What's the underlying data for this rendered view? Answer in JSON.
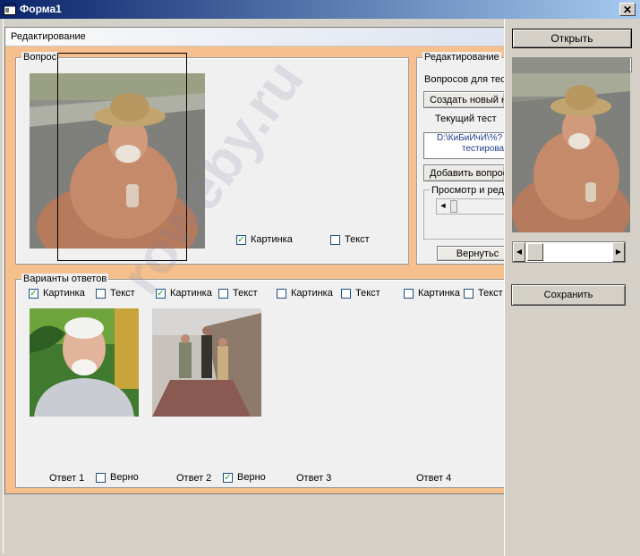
{
  "window": {
    "title": "Форма1",
    "close_glyph": "✕"
  },
  "editor": {
    "header": "Редактирование",
    "question_group": {
      "label": "Вопрос",
      "picture_checkbox": {
        "label": "Картинка",
        "checked": true
      },
      "text_checkbox": {
        "label": "Текст",
        "checked": false
      }
    },
    "edit_group": {
      "label": "Редактирование",
      "questions_label": "Вопросов для тест",
      "create_new_button": "Создать новый н",
      "current_test_label": "Текущий тест",
      "current_test_path": "D:\\КиБиИчИ\\%?",
      "current_test_path_line2": "тестирова",
      "add_question_button": "Добавить вопрос",
      "view_edit_label": "Просмотр и реда",
      "back_button": "Вернутьс"
    },
    "answers_group": {
      "label": "Варианты ответов",
      "answers": [
        {
          "picture_label": "Картинка",
          "picture_checked": true,
          "text_label": "Текст",
          "text_checked": false,
          "name": "Ответ 1",
          "correct_label": "Верно",
          "correct_checked": false
        },
        {
          "picture_label": "Картинка",
          "picture_checked": true,
          "text_label": "Текст",
          "text_checked": false,
          "name": "Ответ 2",
          "correct_label": "Верно",
          "correct_checked": true
        },
        {
          "picture_label": "Картинка",
          "picture_checked": false,
          "text_label": "Текст",
          "text_checked": false,
          "name": "Ответ 3"
        },
        {
          "picture_label": "Картинка",
          "picture_checked": false,
          "text_label": "Текст",
          "text_checked": false,
          "name": "Ответ 4"
        }
      ]
    }
  },
  "side_panel": {
    "open_button": "Открыть",
    "save_button": "Сохранить"
  },
  "glyphs": {
    "check": "✓",
    "arrow_left": "◀",
    "arrow_right": "▶"
  },
  "watermark": "roweby.ru",
  "colors": {
    "title_start": "#0a246a",
    "title_end": "#a6caf0",
    "frame_orange": "#f5c08d",
    "window_bg": "#d4d0c8"
  }
}
